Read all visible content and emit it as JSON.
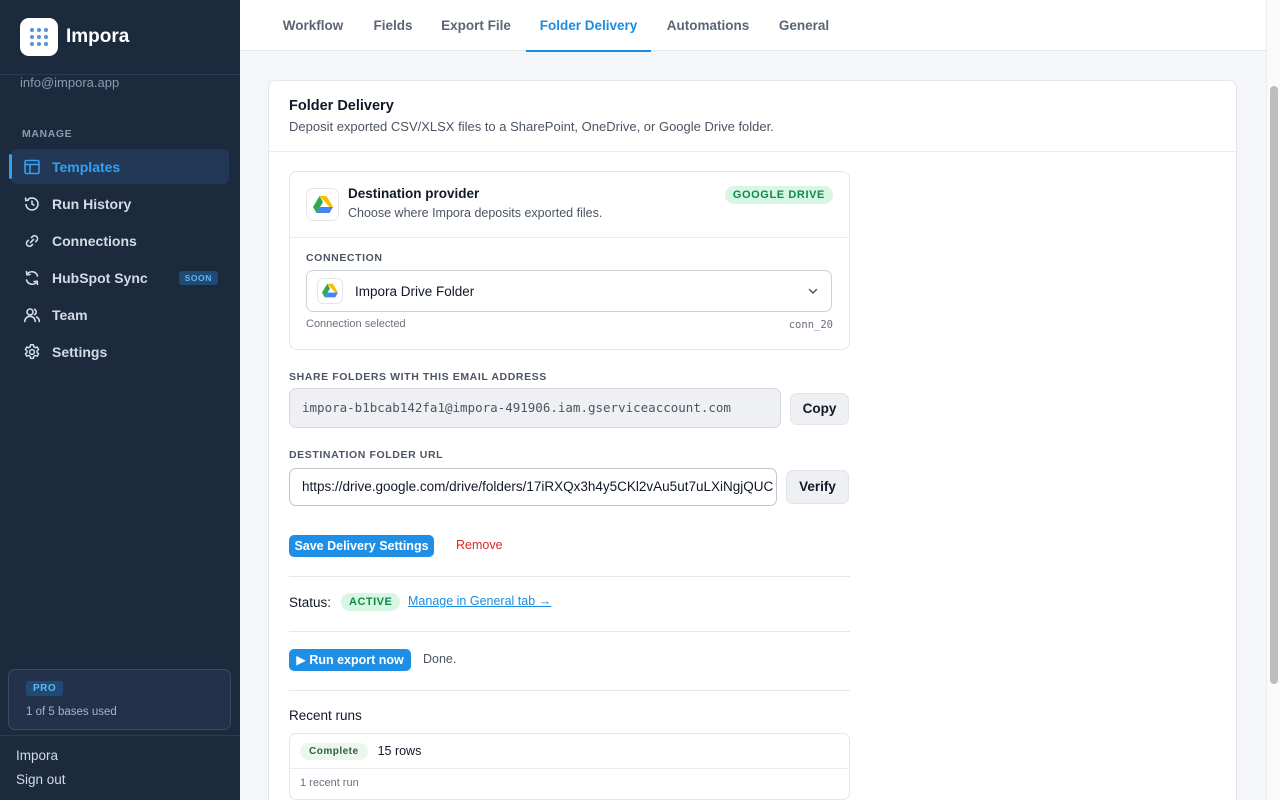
{
  "app": {
    "name": "Impora",
    "account_email": "info@impora.app"
  },
  "sidebar": {
    "section_label": "MANAGE",
    "items": [
      {
        "label": "Templates",
        "icon": "layout-icon",
        "active": true
      },
      {
        "label": "Run History",
        "icon": "history-icon"
      },
      {
        "label": "Connections",
        "icon": "link-icon"
      },
      {
        "label": "HubSpot Sync",
        "icon": "sync-icon",
        "badge": "SOON"
      },
      {
        "label": "Team",
        "icon": "users-icon"
      },
      {
        "label": "Settings",
        "icon": "gear-icon"
      }
    ],
    "plan": {
      "badge": "PRO",
      "usage": "1 of 5 bases used"
    },
    "footer": {
      "org": "Impora",
      "sign_out": "Sign out"
    }
  },
  "tabs": [
    {
      "label": "Workflow"
    },
    {
      "label": "Fields"
    },
    {
      "label": "Export File"
    },
    {
      "label": "Folder Delivery",
      "active": true
    },
    {
      "label": "Automations"
    },
    {
      "label": "General"
    }
  ],
  "card": {
    "title": "Folder Delivery",
    "subtitle": "Deposit exported CSV/XLSX files to a SharePoint, OneDrive, or Google Drive folder."
  },
  "provider": {
    "title": "Destination provider",
    "description": "Choose where Impora deposits exported files.",
    "badge": "GOOGLE DRIVE",
    "connection_label": "CONNECTION",
    "connection_value": "Impora Drive Folder",
    "connection_status": "Connection selected",
    "connection_id": "conn_20"
  },
  "share": {
    "label": "SHARE FOLDERS WITH THIS EMAIL ADDRESS",
    "value": "impora-b1bcab142fa1@impora-491906.iam.gserviceaccount.com",
    "copy_label": "Copy"
  },
  "destination": {
    "label": "DESTINATION FOLDER URL",
    "value": "https://drive.google.com/drive/folders/17iRXQx3h4y5CKl2vAu5ut7uLXiNgjQUC",
    "verify_label": "Verify"
  },
  "actions": {
    "save_label": "Save Delivery Settings",
    "remove_label": "Remove"
  },
  "status": {
    "label": "Status:",
    "value": "ACTIVE",
    "manage_link": "Manage in General tab →"
  },
  "run": {
    "button_label": "▶ Run export now",
    "result": "Done."
  },
  "recent_runs": {
    "title": "Recent runs",
    "rows": [
      {
        "status": "Complete",
        "detail": "15 rows"
      }
    ],
    "footer": "1 recent run"
  },
  "colors": {
    "accent": "#1a8de0",
    "sidebar_bg": "#1c2a3e",
    "success": "#0e8a4a",
    "danger": "#dc2626"
  }
}
